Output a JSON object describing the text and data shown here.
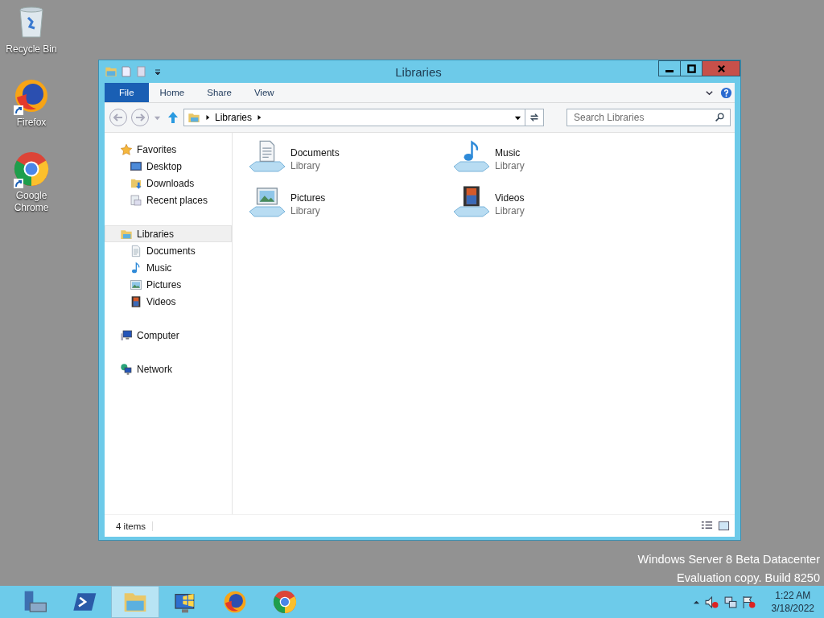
{
  "desktop_icons": [
    {
      "label": "Recycle Bin",
      "kind": "recycle"
    },
    {
      "label": "Firefox",
      "kind": "firefox"
    },
    {
      "label": "Google Chrome",
      "kind": "chrome"
    }
  ],
  "window": {
    "title": "Libraries",
    "ribbon_tabs": [
      {
        "label": "File",
        "kind": "file",
        "selected": false
      },
      {
        "label": "Home",
        "kind": "tab",
        "selected": false
      },
      {
        "label": "Share",
        "kind": "tab",
        "selected": false
      },
      {
        "label": "View",
        "kind": "tab",
        "selected": false
      }
    ],
    "address": {
      "path": "Libraries"
    },
    "search": {
      "placeholder": "Search Libraries"
    },
    "sidebar": [
      {
        "label": "Favorites",
        "kind": "star",
        "selected": false,
        "children": [
          {
            "label": "Desktop",
            "kind": "desktop",
            "selected": false
          },
          {
            "label": "Downloads",
            "kind": "downloads",
            "selected": false
          },
          {
            "label": "Recent places",
            "kind": "recent",
            "selected": false
          }
        ]
      },
      {
        "label": "Libraries",
        "kind": "libraries",
        "selected": true,
        "children": [
          {
            "label": "Documents",
            "kind": "documents",
            "selected": false
          },
          {
            "label": "Music",
            "kind": "music",
            "selected": false
          },
          {
            "label": "Pictures",
            "kind": "pictures",
            "selected": false
          },
          {
            "label": "Videos",
            "kind": "videos",
            "selected": false
          }
        ]
      },
      {
        "label": "Computer",
        "kind": "computer",
        "selected": false
      },
      {
        "label": "Network",
        "kind": "network",
        "selected": false
      }
    ],
    "items": [
      {
        "name": "Documents",
        "type": "Library",
        "kind": "documents"
      },
      {
        "name": "Music",
        "type": "Library",
        "kind": "music"
      },
      {
        "name": "Pictures",
        "type": "Library",
        "kind": "pictures"
      },
      {
        "name": "Videos",
        "type": "Library",
        "kind": "videos"
      }
    ],
    "status_bar": "4 items"
  },
  "os_notice": [
    "Windows Server 8 Beta Datacenter",
    "Evaluation copy. Build 8250"
  ],
  "taskbar": {
    "apps": [
      {
        "kind": "server",
        "selected": false
      },
      {
        "kind": "powershell",
        "selected": false
      },
      {
        "kind": "explorer",
        "selected": true
      },
      {
        "kind": "installer",
        "selected": false
      },
      {
        "kind": "firefox",
        "selected": false
      },
      {
        "kind": "chrome",
        "selected": false
      }
    ],
    "time": "1:22 AM",
    "date": "3/18/2022"
  }
}
